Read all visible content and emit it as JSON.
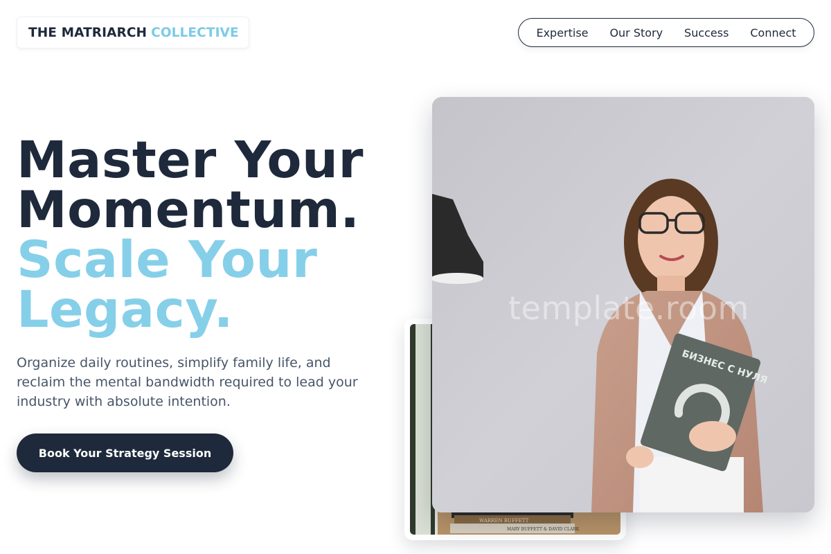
{
  "brand": {
    "name_dark": "THE MATRIARCH",
    "name_accent": "COLLECTIVE"
  },
  "nav": {
    "items": [
      "Expertise",
      "Our Story",
      "Success",
      "Connect"
    ]
  },
  "hero": {
    "headline_line1": "Master Your",
    "headline_line2": "Momentum.",
    "headline_line3": "Scale Your",
    "headline_line4": "Legacy.",
    "subtext": "Organize daily routines, simplify family life, and reclaim the mental bandwidth required to lead your industry with absolute intention.",
    "cta_label": "Book Your Strategy Session"
  },
  "images": {
    "main_watermark": "template.room",
    "book_title": "БИЗНЕС С НУЛЯ",
    "book_spine_1": "WARREN BUFFETT",
    "book_spine_2": "MARY BUFFETT & DAVID CLARK"
  },
  "colors": {
    "primary": "#1e293b",
    "accent": "#86cfe9",
    "muted": "#475569"
  }
}
